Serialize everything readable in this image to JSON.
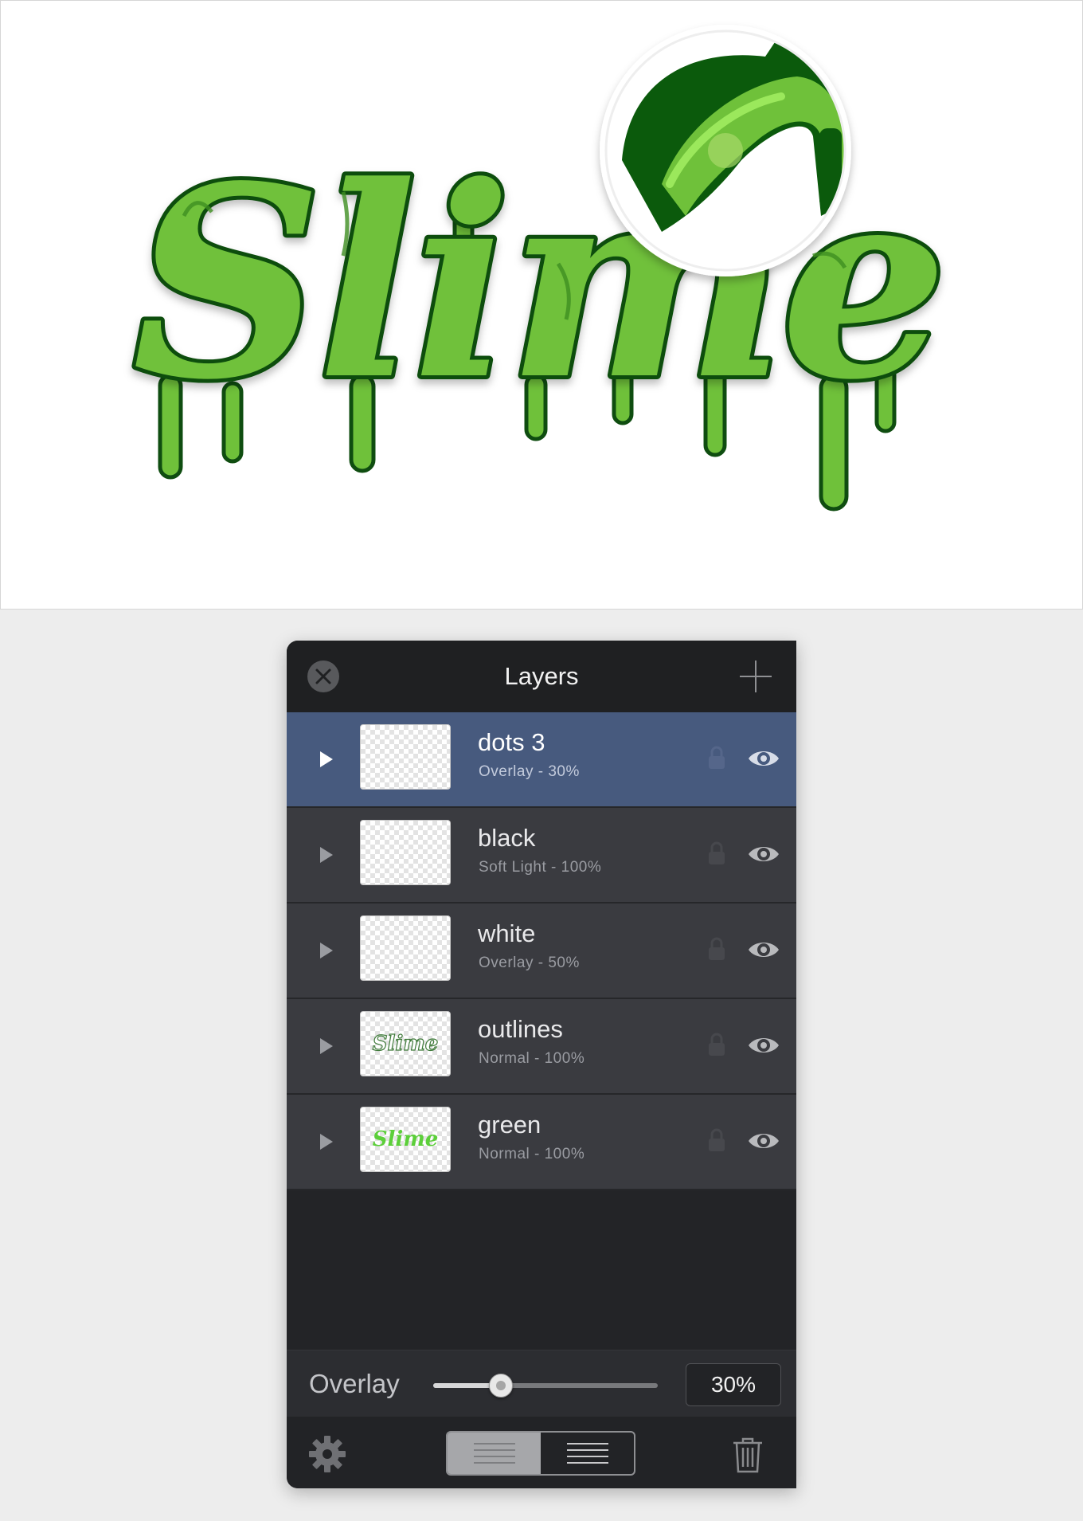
{
  "canvas": {
    "artwork_text": "Slime"
  },
  "panel": {
    "title": "Layers",
    "layers": [
      {
        "name": "dots 3",
        "blend": "Overlay - 30%",
        "selected": true,
        "thumbnail": "empty"
      },
      {
        "name": "black",
        "blend": "Soft Light - 100%",
        "selected": false,
        "thumbnail": "empty"
      },
      {
        "name": "white",
        "blend": "Overlay - 50%",
        "selected": false,
        "thumbnail": "empty"
      },
      {
        "name": "outlines",
        "blend": "Normal - 100%",
        "selected": false,
        "thumbnail": "Slime"
      },
      {
        "name": "green",
        "blend": "Normal - 100%",
        "selected": false,
        "thumbnail": "Slime"
      }
    ],
    "options": {
      "blend_mode": "Overlay",
      "opacity_value": 0.3,
      "opacity_text": "30%"
    }
  },
  "colors": {
    "selected_row": "#475a7e",
    "row": "#3a3b40",
    "slime_fill": "#6fc13a",
    "slime_outline": "#0f4d10"
  }
}
